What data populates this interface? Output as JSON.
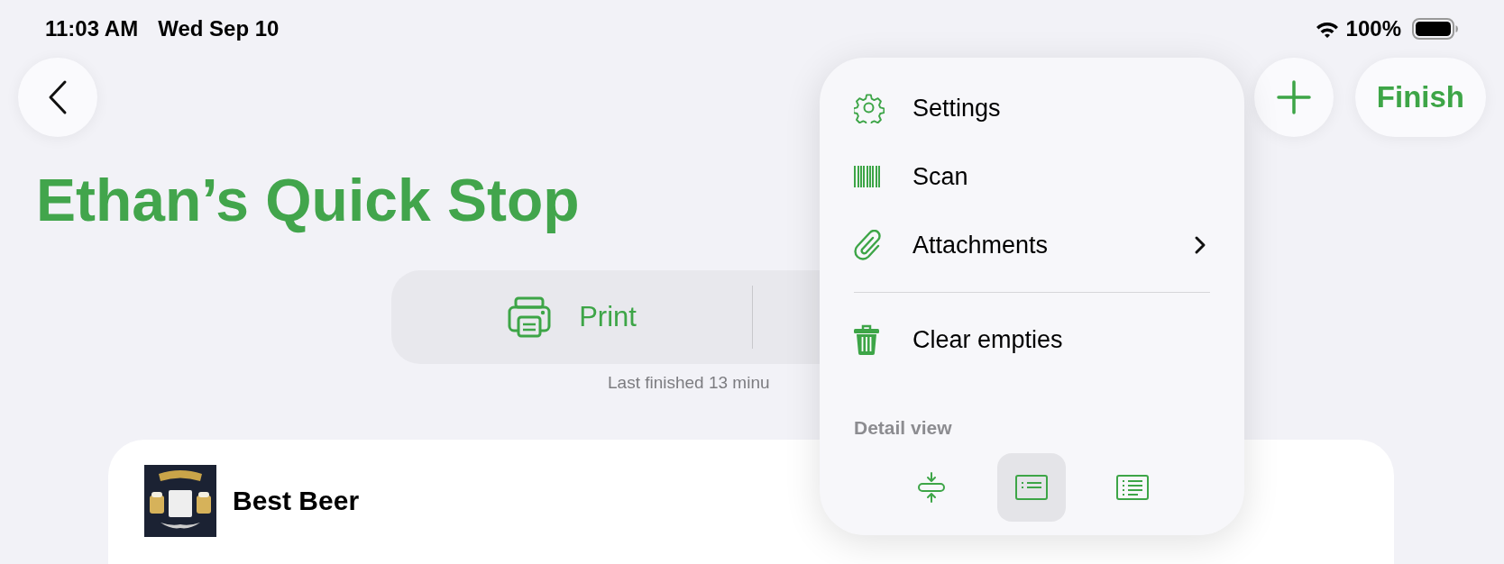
{
  "status_bar": {
    "time": "11:03 AM",
    "date": "Wed Sep 10",
    "battery": "100%"
  },
  "toolbar": {
    "finish": "Finish"
  },
  "title": "Ethan’s Quick Stop",
  "segments": [
    {
      "label": "Print"
    }
  ],
  "last_finished": "Last finished 13 minu",
  "list": [
    {
      "name": "Best Beer"
    }
  ],
  "menu": {
    "sections": [
      [
        {
          "label": "Settings",
          "submenu": false
        },
        {
          "label": "Scan",
          "submenu": false
        },
        {
          "label": "Attachments",
          "submenu": true
        }
      ],
      [
        {
          "label": "Clear empties",
          "submenu": false
        }
      ]
    ],
    "detail_view": {
      "label": "Detail view",
      "options": [
        {
          "selected": false
        },
        {
          "selected": true
        },
        {
          "selected": false
        }
      ]
    }
  }
}
